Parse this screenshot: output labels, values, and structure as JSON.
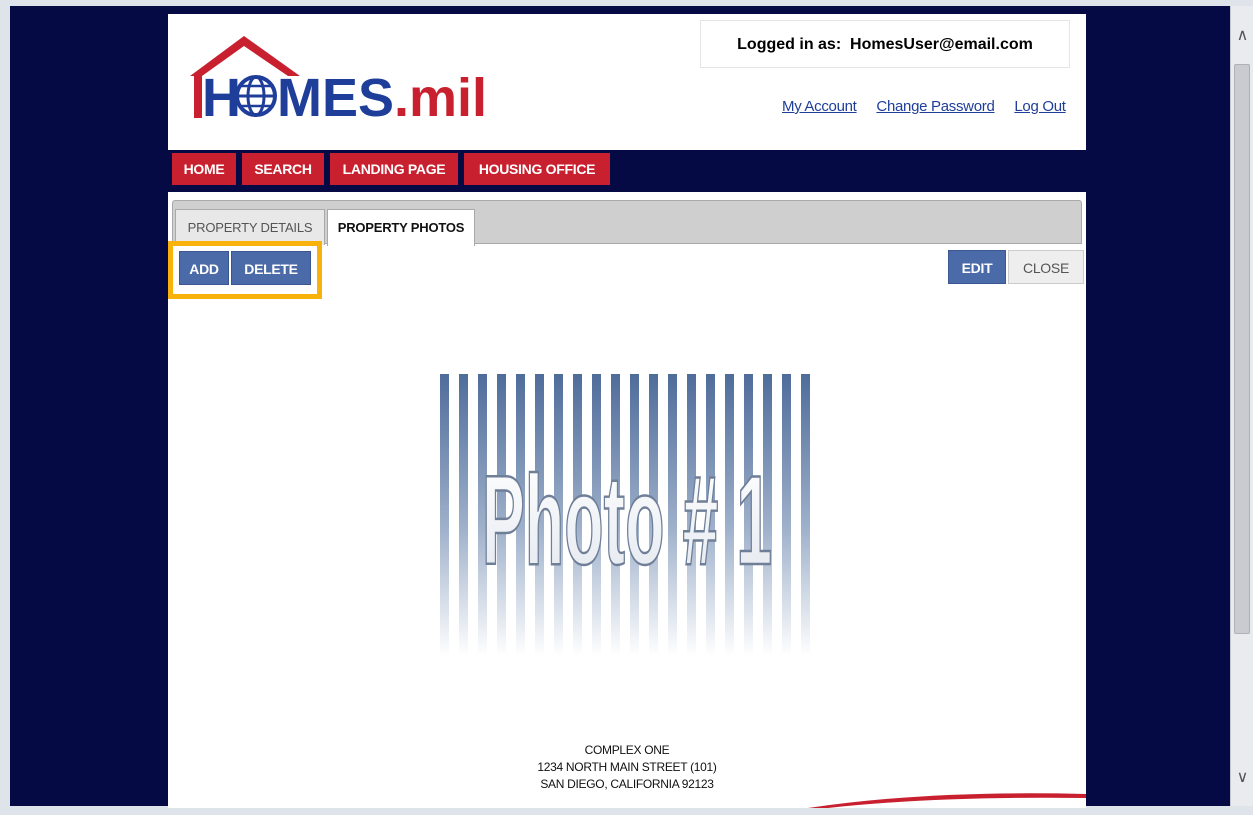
{
  "logo": {
    "text_part1": "H",
    "text_part2": "MES",
    "text_part3": ".mil"
  },
  "login": {
    "label": "Logged in as:",
    "user": "HomesUser@email.com"
  },
  "header_links": [
    {
      "label": "My Account"
    },
    {
      "label": "Change Password"
    },
    {
      "label": "Log Out"
    }
  ],
  "nav": [
    {
      "label": "HOME"
    },
    {
      "label": "SEARCH"
    },
    {
      "label": "LANDING PAGE"
    },
    {
      "label": "HOUSING OFFICE"
    }
  ],
  "tabs": [
    {
      "label": "PROPERTY DETAILS",
      "active": false
    },
    {
      "label": "PROPERTY PHOTOS",
      "active": true
    }
  ],
  "actions": {
    "add": "ADD",
    "delete": "DELETE",
    "edit": "EDIT",
    "close": "CLOSE"
  },
  "photo": {
    "label": "Photo # 1"
  },
  "property": {
    "name": "COMPLEX ONE",
    "street": "1234 NORTH MAIN STREET (101)",
    "city": "SAN DIEGO, CALIFORNIA 92123"
  },
  "scrollbar": {
    "up_icon": "chevron-up-icon",
    "down_icon": "chevron-down-icon"
  },
  "colors": {
    "navy": "#050a45",
    "nav_red": "#c8202f",
    "button_blue": "#4a6aa8",
    "highlight": "#f9b10b",
    "logo_blue": "#1f3e9a",
    "logo_red": "#c8202f"
  }
}
